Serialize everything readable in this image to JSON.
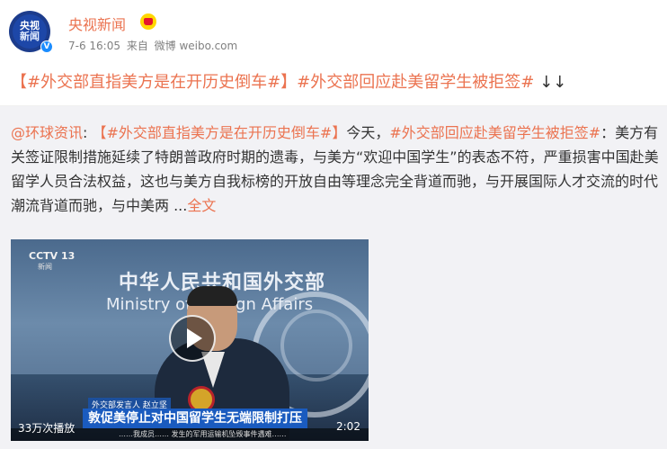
{
  "post": {
    "author": {
      "name": "央视新闻",
      "avatar_line1": "央视",
      "avatar_line2": "新闻",
      "verified_badge": "V"
    },
    "timestamp": "7-6 16:05",
    "source_prefix": "来自",
    "source_app": "微博 weibo.com",
    "headline_tag1": "【#外交部直指美方是在开历史倒车#】",
    "headline_tag2": "#外交部回应赴美留学生被拒签#",
    "headline_arrows": "↓↓"
  },
  "repost": {
    "mention": "@环球资讯",
    "colon": ": ",
    "tag_part": "【#外交部直指美方是在开历史倒车#】",
    "intro": "今天，",
    "tag2": "#外交部回应赴美留学生被拒签#",
    "body": "：美方有关签证限制措施延续了特朗普政府时期的遗毒，与美方“欢迎中国学生”的表态不符，严重损害中国赴美留学人员合法权益，这也与美方自我标榜的开放自由等理念完全背道而驰，与开展国际人才交流的时代潮流背道而驰，与中美两 ...",
    "full_text_link": "全文"
  },
  "video": {
    "channel_logo": "CCTV 13",
    "channel_sub": "新闻",
    "backdrop_cn": "中华人民共和国外交部",
    "backdrop_en": "Ministry of Foreign Affairs",
    "lower_small": "外交部发言人  赵立坚",
    "lower_third": "敦促美停止对中国留学生无端限制打压",
    "ticker": "……我成员…… 发生的军用运输机坠毁事件遇难……",
    "view_count": "33万次播放",
    "duration": "2:02"
  },
  "colors": {
    "accent": "#eb7350",
    "repost_bg": "#f2f2f5",
    "meta_text": "#808080"
  }
}
